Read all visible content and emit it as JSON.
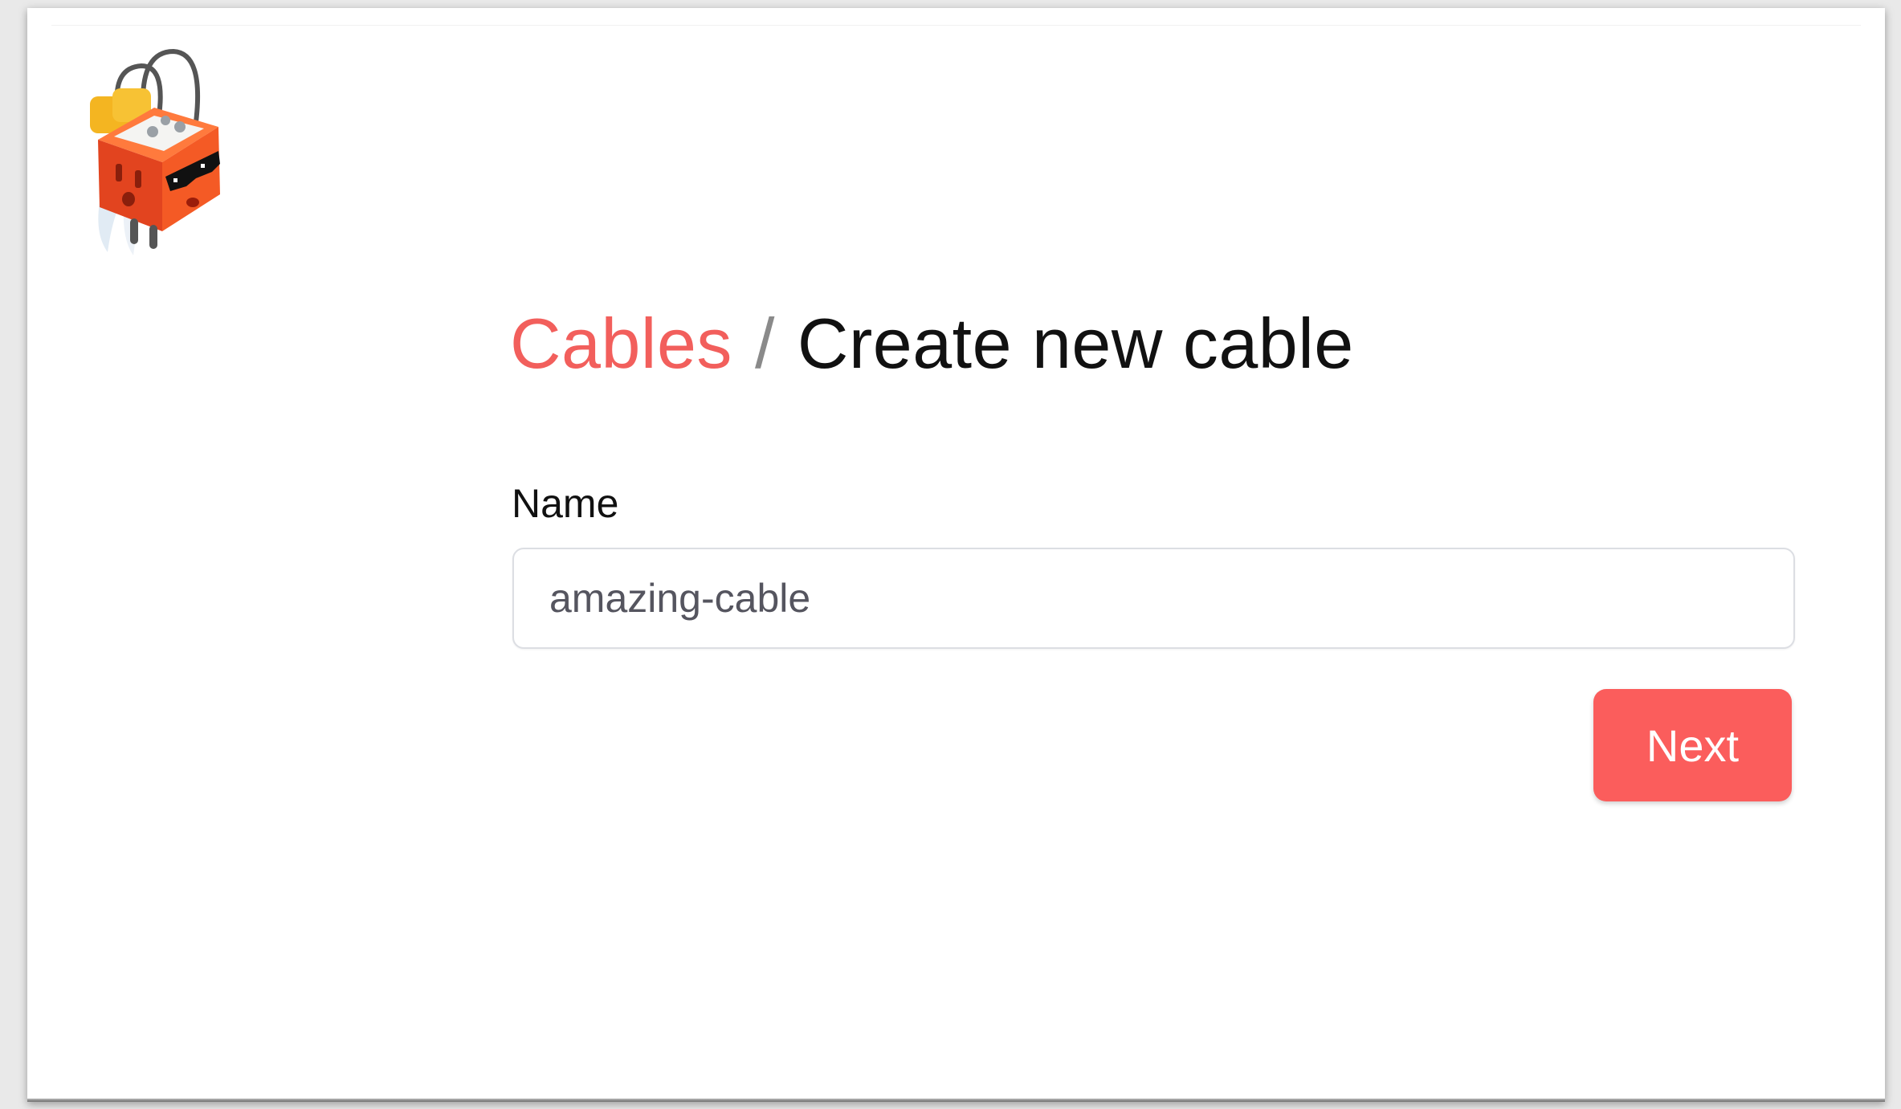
{
  "breadcrumb": {
    "parent": "Cables",
    "separator": "/",
    "current": "Create new cable"
  },
  "form": {
    "name_label": "Name",
    "name_value": "amazing-cable"
  },
  "actions": {
    "next_label": "Next"
  },
  "logo": {
    "icon": "power-outlet-mascot-icon"
  },
  "colors": {
    "accent": "#fb5d5c",
    "heading": "#111111",
    "input_border": "#dcdee3"
  }
}
